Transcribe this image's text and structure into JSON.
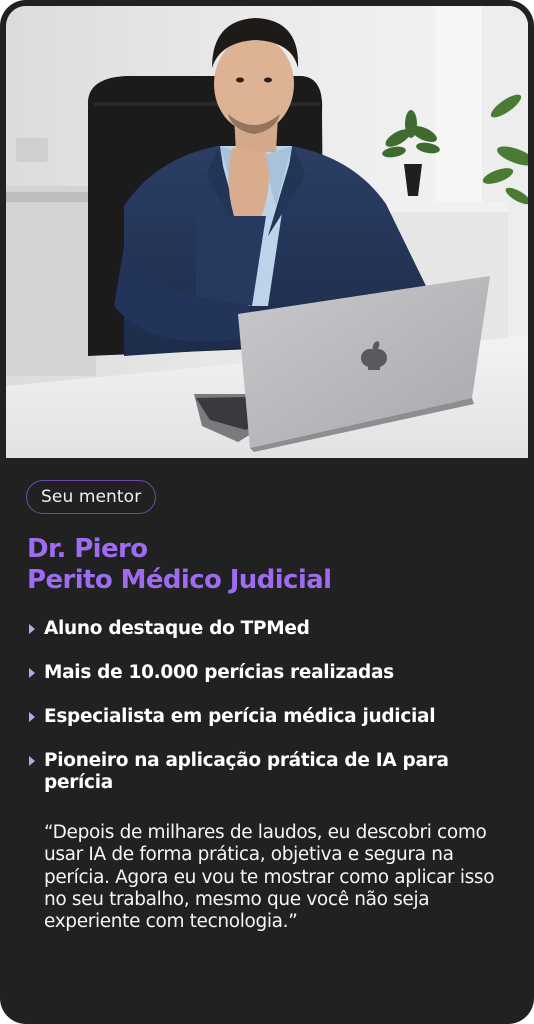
{
  "photo": {
    "subject": "Dr. Piero portrait",
    "laptop_icon": "apple-logo-icon"
  },
  "badge": {
    "label": "Seu mentor"
  },
  "headline": {
    "line1": "Dr. Piero",
    "line2": "Perito Médico Judicial"
  },
  "bullets": [
    "Aluno destaque do TPMed",
    "Mais de 10.000 perícias realizadas",
    "Especialista em perícia médica judicial",
    "Pioneiro na aplicação prática de IA para perícia"
  ],
  "quote": {
    "text": "“Depois de milhares de laudos, eu descobri como usar IA de forma prática, objetiva e segura na perícia. Agora eu vou te mostrar como aplicar isso no seu trabalho, mesmo que você não seja experiente com tecnologia.”"
  },
  "colors": {
    "card_bg": "#222122",
    "accent_purple": "#9d6cf0",
    "badge_border": "#6d4bb0",
    "bullet_arrow": "#b9a7ee"
  }
}
